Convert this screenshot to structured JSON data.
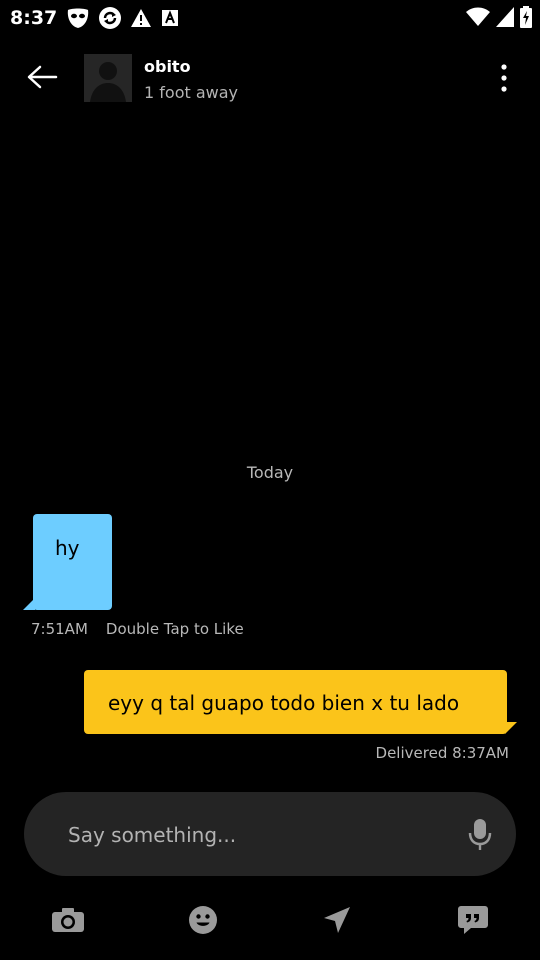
{
  "status_bar": {
    "time": "8:37",
    "left_icons": [
      "grindr-mask-icon",
      "sync-icon",
      "warning-icon",
      "font-icon"
    ],
    "right_icons": [
      "wifi-icon",
      "signal-icon",
      "battery-icon"
    ]
  },
  "header": {
    "contact_name": "obito",
    "distance": "1 foot away"
  },
  "conversation": {
    "date_divider": "Today",
    "incoming": {
      "text": "hy",
      "time": "7:51AM",
      "hint": "Double Tap to Like",
      "color": "#6dcdff"
    },
    "outgoing": {
      "text": "eyy q tal guapo todo bien x tu lado",
      "status": "Delivered 8:37AM",
      "color": "#fbc41a"
    }
  },
  "composer": {
    "placeholder": "Say something..."
  },
  "toolbar": {
    "items": [
      "camera-icon",
      "emoji-icon",
      "location-arrow-icon",
      "quick-replies-icon"
    ]
  }
}
